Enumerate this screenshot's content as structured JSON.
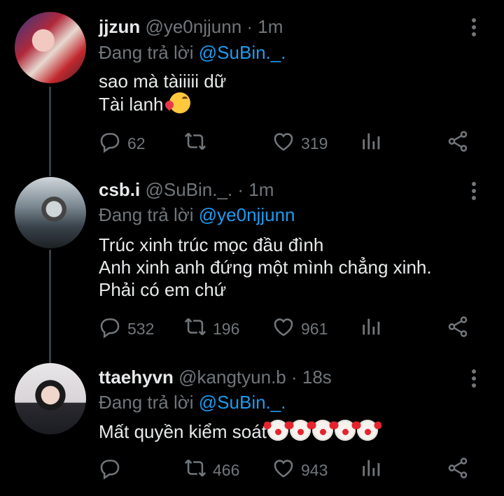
{
  "tweets": [
    {
      "name": "jjzun",
      "handle": "@ye0njjunn",
      "time": "· 1m",
      "reply_prefix": "Đang trả lời ",
      "reply_to": "@SuBin._.",
      "lines": [
        "sao mà tàiiiii dữ",
        "Tài lanh"
      ],
      "emoji": "smiling-face-with-hearts",
      "replies": "62",
      "retweets": "",
      "likes": "319"
    },
    {
      "name": "csb.i",
      "handle": "@SuBin._.",
      "time": "· 1m",
      "reply_prefix": "Đang trả lời ",
      "reply_to": "@ye0njjunn",
      "lines": [
        "Trúc xinh trúc mọc đầu đình",
        "Anh xinh anh đứng một mình chẳng xinh.",
        "Phải có em chứ"
      ],
      "replies": "532",
      "retweets": "196",
      "likes": "961"
    },
    {
      "name": "ttaehyvn",
      "handle": "@kangtyun.b",
      "time": "· 18s",
      "reply_prefix": "Đang trả lời ",
      "reply_to": "@SuBin._.",
      "lines": [
        "Mất quyền kiểm soát"
      ],
      "emoji": "clown-face",
      "emoji_count": 5,
      "replies": "",
      "retweets": "466",
      "likes": "943"
    }
  ],
  "colors": {
    "background": "#000000",
    "text": "#e7e9ea",
    "muted": "#71767b",
    "mention": "#1d9bf0",
    "thread_line": "#3a3e42"
  },
  "icons": [
    "reply-icon",
    "retweet-icon",
    "like-icon",
    "views-icon",
    "share-icon",
    "more-icon"
  ]
}
